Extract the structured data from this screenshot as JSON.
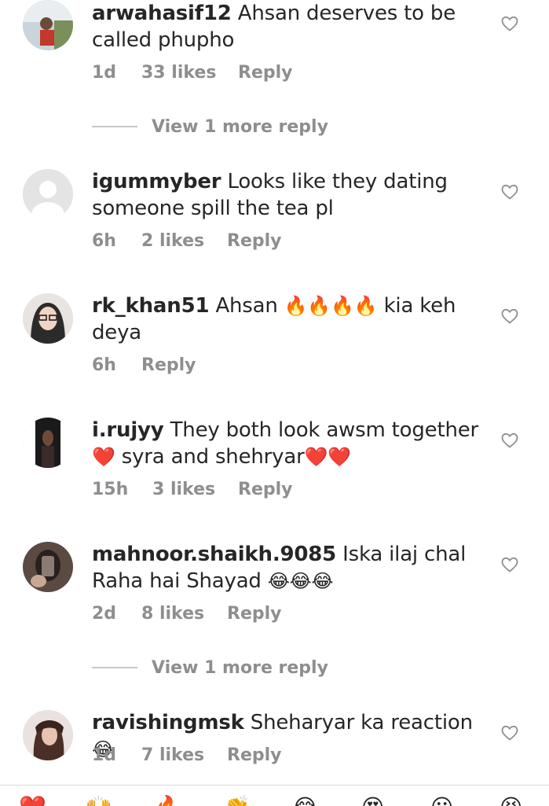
{
  "comments": [
    {
      "username": "arwahasif12",
      "text": "Ahsan deserves to be called phupho",
      "time": "1d",
      "likes": "33 likes",
      "reply": "Reply"
    },
    {
      "username": "igummyber",
      "text": "Looks like they dating someone spill the tea pl",
      "time": "6h",
      "likes": "2 likes",
      "reply": "Reply"
    },
    {
      "username": "rk_khan51",
      "text": "Ahsan",
      "text_emoji": "🔥🔥🔥🔥",
      "text_after": "kia keh deya",
      "time": "6h",
      "likes": "",
      "reply": "Reply"
    },
    {
      "username": "i.rujyy",
      "text": "They both look awsm together",
      "text_line2_emoji": "❤️",
      "text_line2": "syra and shehryar",
      "text_line2_emoji_end": "❤️❤️",
      "time": "15h",
      "likes": "3 likes",
      "reply": "Reply"
    },
    {
      "username": "mahnoor.shaikh.9085",
      "text": "Iska ilaj chal Raha hai Shayad",
      "text_emoji": "😂😂😂",
      "time": "2d",
      "likes": "8 likes",
      "reply": "Reply"
    },
    {
      "username": "ravishingmsk",
      "text": "Sheharyar ka reaction",
      "text_emoji": "😂",
      "time": "1d",
      "likes": "7 likes",
      "reply": "Reply"
    }
  ],
  "view_more": [
    "View 1 more reply",
    "View 1 more reply"
  ],
  "icons": {
    "heart": "heart-outline-icon",
    "emoji_bar": [
      "red-heart",
      "raised-hands",
      "fire",
      "clap",
      "crying-laughing",
      "heart-eyes",
      "astonished",
      "laughing"
    ]
  },
  "colors": {
    "primary_text": "#262626",
    "secondary_text": "#8e8e8e",
    "divider": "#c7c7c7"
  }
}
